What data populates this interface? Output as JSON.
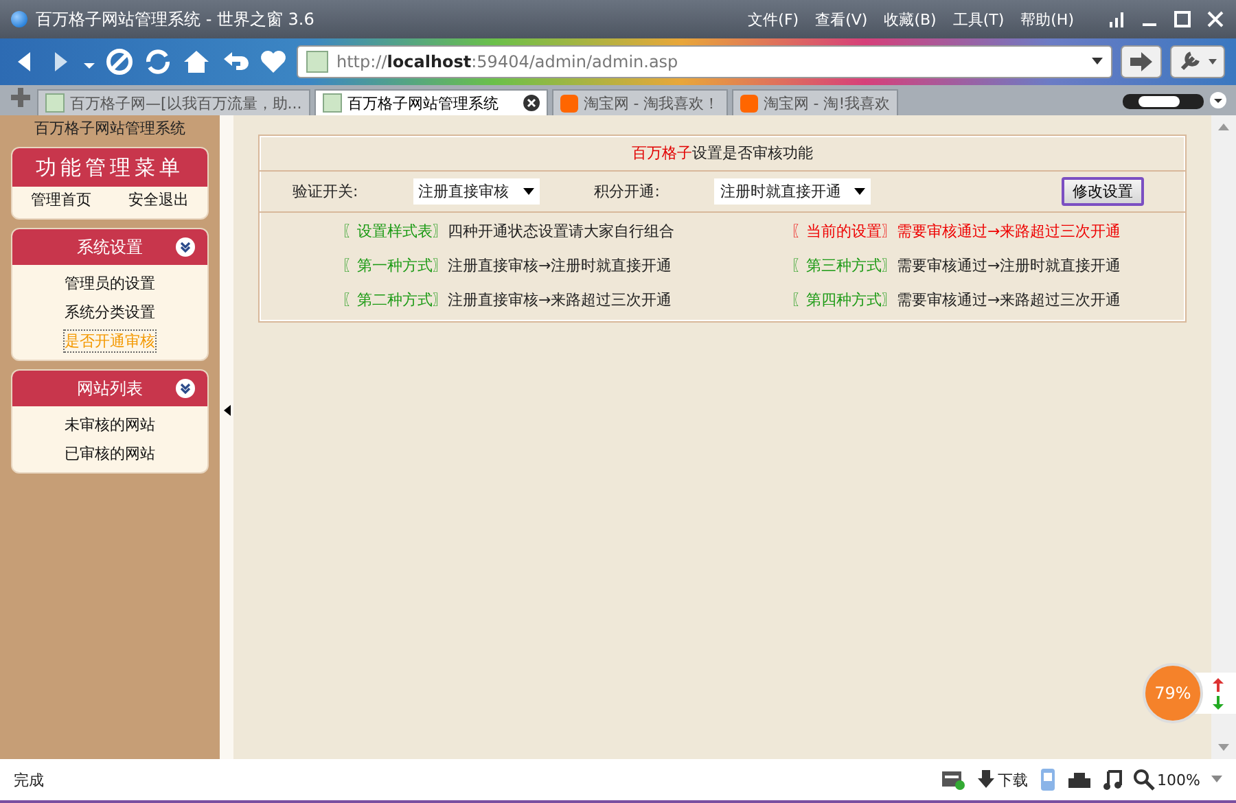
{
  "window": {
    "title": "百万格子网站管理系统 - 世界之窗 3.6",
    "menu": [
      "文件(F)",
      "查看(V)",
      "收藏(B)",
      "工具(T)",
      "帮助(H)"
    ]
  },
  "address_bar": {
    "value": "http://**localhost**:59404/admin/admin.asp"
  },
  "tabs": [
    {
      "label": "百万格子网—[以我百万流量，助...",
      "selected": false,
      "kind": "page"
    },
    {
      "label": "百万格子网站管理系统",
      "selected": true,
      "kind": "page"
    },
    {
      "label": "淘宝网 - 淘我喜欢！",
      "selected": false,
      "kind": "taobao"
    },
    {
      "label": "淘宝网 - 淘!我喜欢",
      "selected": false,
      "kind": "taobao"
    }
  ],
  "sidebar": {
    "heading": "百万格子网站管理系统",
    "menu_title": "功能管理菜单",
    "links": [
      "管理首页",
      "安全退出"
    ],
    "sections": [
      {
        "title": "系统设置",
        "items": [
          {
            "label": "管理员的设置",
            "selected": false
          },
          {
            "label": "系统分类设置",
            "selected": false
          },
          {
            "label": "是否开通审核",
            "selected": true
          }
        ]
      },
      {
        "title": "网站列表",
        "items": [
          {
            "label": "未审核的网站",
            "selected": false
          },
          {
            "label": "已审核的网站",
            "selected": false
          }
        ]
      }
    ]
  },
  "main": {
    "title_highlight": "百万格子",
    "title": "设置是否审核功能",
    "verify_label": "验证开关:",
    "verify_value": "注册直接审核",
    "points_label": "积分开通:",
    "points_value": "注册时就直接开通",
    "submit": "修改设置",
    "rows": [
      {
        "tag": "〖设置样式表〗",
        "text": "四种开通状态设置请大家自行组合",
        "kind": "normal"
      },
      {
        "tag": "〖当前的设置〗",
        "text": "需要审核通过→来路超过三次开通",
        "kind": "current"
      },
      {
        "tag": "〖第一种方式〗",
        "text": "注册直接审核→注册时就直接开通",
        "kind": "normal"
      },
      {
        "tag": "〖第三种方式〗",
        "text": "需要审核通过→注册时就直接开通",
        "kind": "normal"
      },
      {
        "tag": "〖第二种方式〗",
        "text": "注册直接审核→来路超过三次开通",
        "kind": "normal"
      },
      {
        "tag": "〖第四种方式〗",
        "text": "需要审核通过→来路超过三次开通",
        "kind": "normal"
      }
    ]
  },
  "status_bar": {
    "text": "完成",
    "download": "下载",
    "zoom": "100%"
  },
  "speed_meter": {
    "reading": "79%"
  }
}
